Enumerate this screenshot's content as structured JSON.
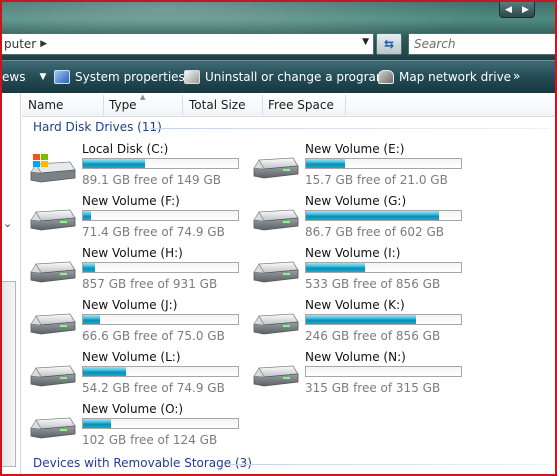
{
  "address": {
    "breadcrumb_text": "puter",
    "search_placeholder": "Search"
  },
  "toolbar": {
    "views_label": "ews",
    "system_properties_label": "System properties",
    "uninstall_label": "Uninstall or change a program",
    "map_drive_label": "Map network drive",
    "more_label": "»"
  },
  "columns": {
    "name": "Name",
    "type": "Type",
    "total_size": "Total Size",
    "free_space": "Free Space"
  },
  "groups": {
    "hard_disk_label": "Hard Disk Drives (11)",
    "removable_label": "Devices with Removable Storage (3)"
  },
  "drives": [
    {
      "name": "Local Disk (C:)",
      "free_text": "89.1 GB free of 149 GB",
      "used_fraction": 0.4,
      "icon": "windows-drive-icon"
    },
    {
      "name": "New Volume (E:)",
      "free_text": "15.7 GB free of 21.0 GB",
      "used_fraction": 0.25,
      "icon": "hard-drive-icon"
    },
    {
      "name": "New Volume (F:)",
      "free_text": "71.4 GB free of 74.9 GB",
      "used_fraction": 0.05,
      "icon": "hard-drive-icon"
    },
    {
      "name": "New Volume (G:)",
      "free_text": "86.7 GB free of 602 GB",
      "used_fraction": 0.86,
      "icon": "hard-drive-icon"
    },
    {
      "name": "New Volume (H:)",
      "free_text": "857 GB free of 931 GB",
      "used_fraction": 0.08,
      "icon": "hard-drive-icon"
    },
    {
      "name": "New Volume (I:)",
      "free_text": "533 GB free of 856 GB",
      "used_fraction": 0.38,
      "icon": "hard-drive-icon"
    },
    {
      "name": "New Volume (J:)",
      "free_text": "66.6 GB free of 75.0 GB",
      "used_fraction": 0.11,
      "icon": "hard-drive-icon"
    },
    {
      "name": "New Volume (K:)",
      "free_text": "246 GB free of 856 GB",
      "used_fraction": 0.71,
      "icon": "hard-drive-icon"
    },
    {
      "name": "New Volume (L:)",
      "free_text": "54.2 GB free of 74.9 GB",
      "used_fraction": 0.28,
      "icon": "hard-drive-icon"
    },
    {
      "name": "New Volume (N:)",
      "free_text": "315 GB free of 315 GB",
      "used_fraction": 0.0,
      "icon": "hard-drive-icon"
    },
    {
      "name": "New Volume (O:)",
      "free_text": "102 GB free of 124 GB",
      "used_fraction": 0.18,
      "icon": "hard-drive-icon"
    }
  ],
  "colors": {
    "group_title": "#1e3f8e",
    "bar_fill": "#29b3d4",
    "frame_border": "#c8161c"
  }
}
